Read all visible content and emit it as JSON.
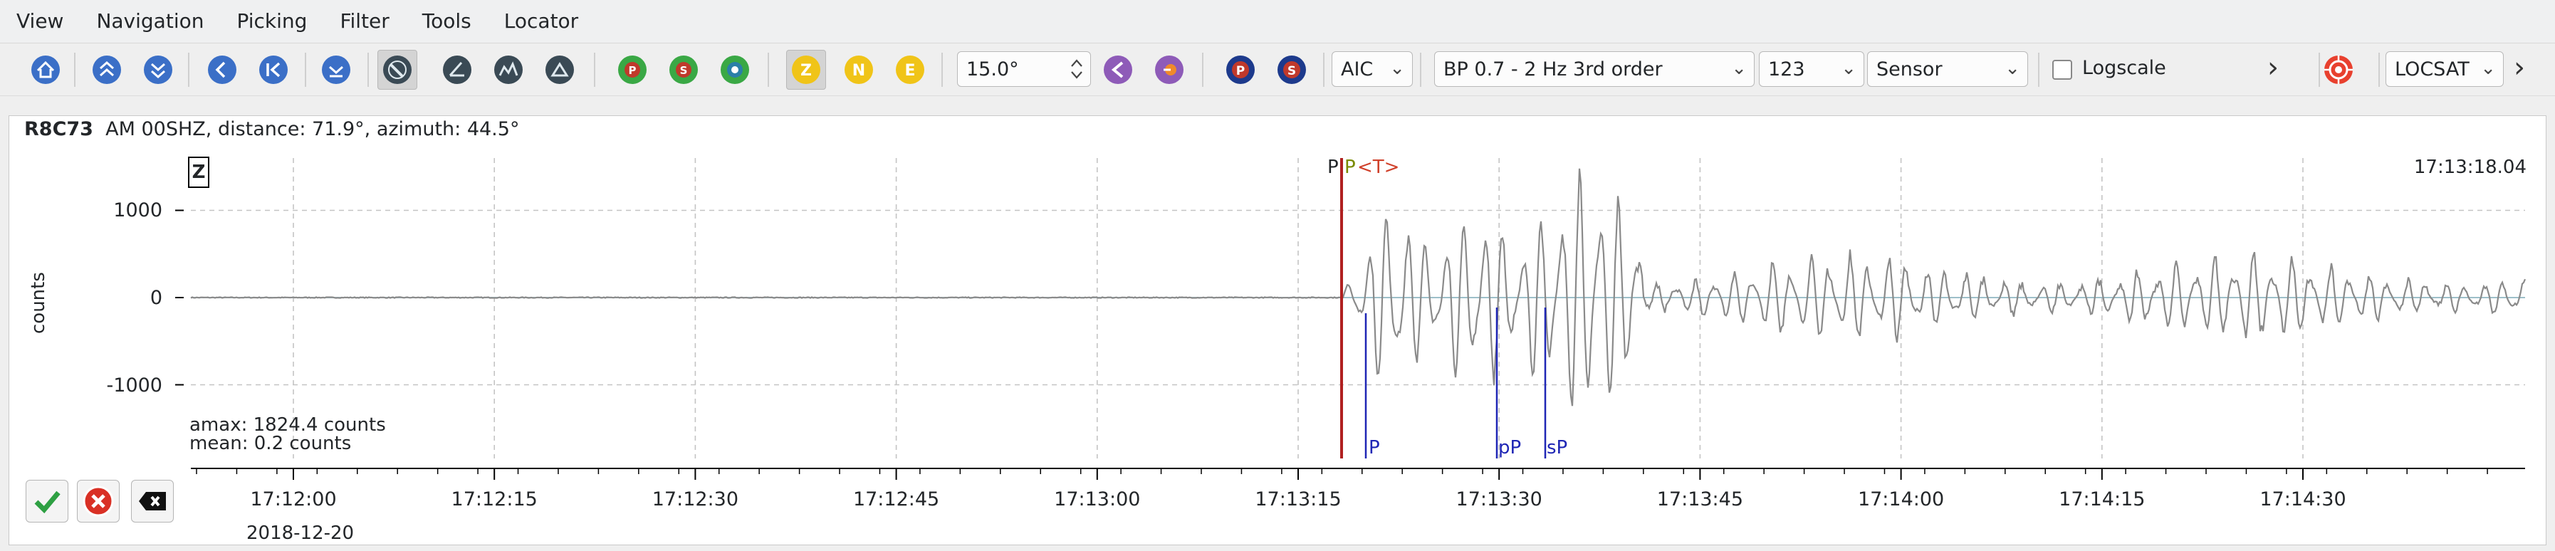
{
  "menu": [
    "View",
    "Navigation",
    "Picking",
    "Filter",
    "Tools",
    "Locator"
  ],
  "toolbar": {
    "angle": "15.0°",
    "method": "AIC",
    "filter": "BP 0.7 - 2 Hz  3rd order",
    "rotation": "123",
    "unit": "Sensor",
    "logscale_label": "Logscale",
    "logscale_checked": false,
    "overflow_1": "›",
    "overflow_2": "›",
    "locator": "LOCSAT",
    "component_buttons": [
      "Z",
      "N",
      "E"
    ],
    "phase_buttons": [
      "P",
      "S"
    ]
  },
  "trace": {
    "station": "R8C73",
    "network": "AM",
    "channel": "00SHZ",
    "distance_text": "distance: 71.9°",
    "azimuth_text": "azimuth: 44.5°",
    "header_text": "AM  00SHZ, distance: 71.9°, azimuth: 44.5°",
    "component": "Z",
    "ylabel": "counts",
    "yticks": [
      "1000",
      "0",
      "-1000"
    ],
    "xticks": [
      "17:12:00",
      "17:12:15",
      "17:12:30",
      "17:12:45",
      "17:13:00",
      "17:13:15",
      "17:13:30",
      "17:13:45",
      "17:14:00",
      "17:14:15",
      "17:14:30"
    ],
    "date": "2018-12-20",
    "amax": "amax: 1824.4 counts",
    "mean": "mean: 0.2 counts",
    "time_right": "17:13:18.04",
    "picks_top": [
      "P",
      "P",
      "<T>"
    ],
    "picks_bottom": [
      "P",
      "pP",
      "sP"
    ]
  },
  "chart_data": {
    "type": "line",
    "title": "",
    "xlabel": "",
    "ylabel": "counts",
    "ylim": [
      -1824.4,
      1824.4
    ],
    "xlim": [
      "17:11:53",
      "17:14:48"
    ],
    "series": [
      {
        "values_description": "seismic waveform, near zero before 17:13:18 then oscillating up to ~1800 counts"
      }
    ],
    "markers": [
      {
        "label": "P",
        "time": "17:13:18.04",
        "color": "#000000"
      },
      {
        "label": "P<T>",
        "time": "17:13:18.04",
        "color": "#c0392b"
      },
      {
        "label": "P",
        "time": "17:13:20",
        "color": "#1f26b5"
      },
      {
        "label": "pP",
        "time": "17:13:29.5",
        "color": "#1f26b5"
      },
      {
        "label": "sP",
        "time": "17:13:33.5",
        "color": "#1f26b5"
      }
    ]
  },
  "colors": {
    "waveform": "#8a8a8a",
    "zero_line": "#9dbfc9",
    "pick_red": "#b02020",
    "pick_blue": "#1f26b5",
    "yellow_button": "#f0c418",
    "green_button": "#3aa845",
    "navy_button": "#1d3a8c"
  },
  "bottom_buttons": [
    "accept-icon",
    "reject-icon",
    "close-icon"
  ]
}
